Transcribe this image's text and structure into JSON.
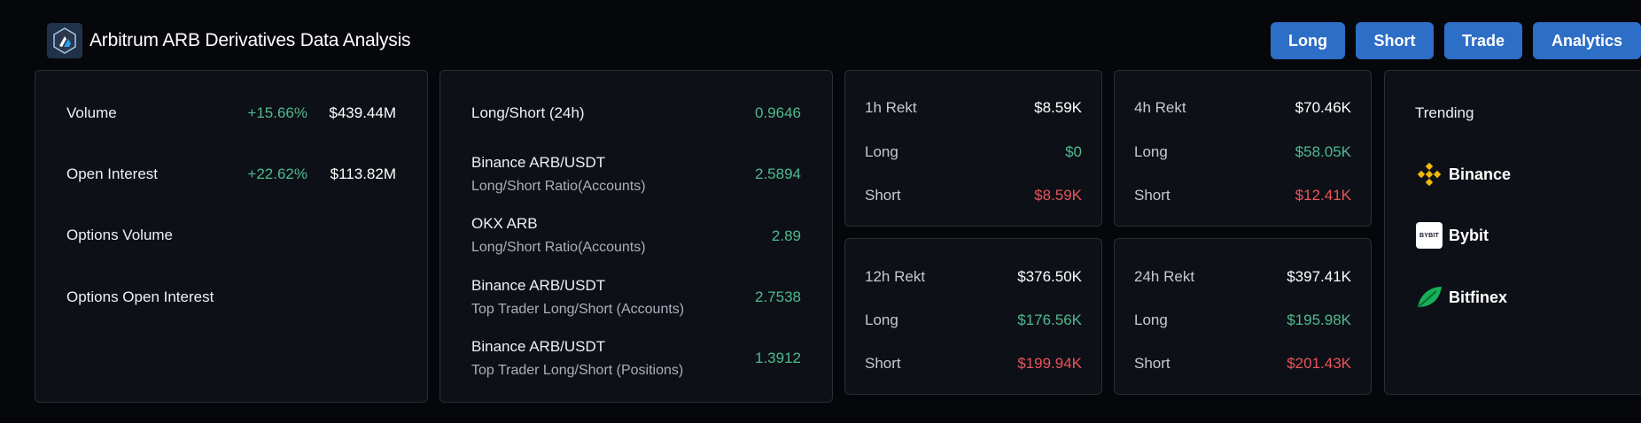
{
  "header": {
    "title": "Arbitrum ARB Derivatives Data Analysis",
    "logo_icon": "arbitrum-logo-icon"
  },
  "nav_buttons": [
    "Long",
    "Short",
    "Trade",
    "Analytics"
  ],
  "colors": {
    "accent": "#2d6ec7",
    "positive": "#4fba8f",
    "negative": "#e8545c",
    "background": "#05070b",
    "card": "#0d1016"
  },
  "overview": {
    "volume_label": "Volume",
    "volume_change": "+15.66%",
    "volume_value": "$439.44M",
    "oi_label": "Open Interest",
    "oi_change": "+22.62%",
    "oi_value": "$113.82M",
    "options_volume_label": "Options Volume",
    "options_oi_label": "Options Open Interest"
  },
  "ratios": {
    "ls24_label": "Long/Short (24h)",
    "ls24_value": "0.9646",
    "items": [
      {
        "title": "Binance ARB/USDT",
        "subtitle": "Long/Short Ratio(Accounts)",
        "value": "2.5894"
      },
      {
        "title": "OKX ARB",
        "subtitle": "Long/Short Ratio(Accounts)",
        "value": "2.89"
      },
      {
        "title": "Binance ARB/USDT",
        "subtitle": "Top Trader Long/Short (Accounts)",
        "value": "2.7538"
      },
      {
        "title": "Binance ARB/USDT",
        "subtitle": "Top Trader Long/Short (Positions)",
        "value": "1.3912"
      }
    ]
  },
  "rekt": [
    {
      "title": "1h Rekt",
      "total": "$8.59K",
      "long_label": "Long",
      "long": "$0",
      "short_label": "Short",
      "short": "$8.59K"
    },
    {
      "title": "4h Rekt",
      "total": "$70.46K",
      "long_label": "Long",
      "long": "$58.05K",
      "short_label": "Short",
      "short": "$12.41K"
    },
    {
      "title": "12h Rekt",
      "total": "$376.50K",
      "long_label": "Long",
      "long": "$176.56K",
      "short_label": "Short",
      "short": "$199.94K"
    },
    {
      "title": "24h Rekt",
      "total": "$397.41K",
      "long_label": "Long",
      "long": "$195.98K",
      "short_label": "Short",
      "short": "$201.43K"
    }
  ],
  "trending": {
    "label": "Trending",
    "items": [
      {
        "name": "Binance",
        "icon": "binance-icon"
      },
      {
        "name": "Bybit",
        "icon": "bybit-icon",
        "icon_text": "BYBIT"
      },
      {
        "name": "Bitfinex",
        "icon": "bitfinex-icon"
      }
    ]
  }
}
